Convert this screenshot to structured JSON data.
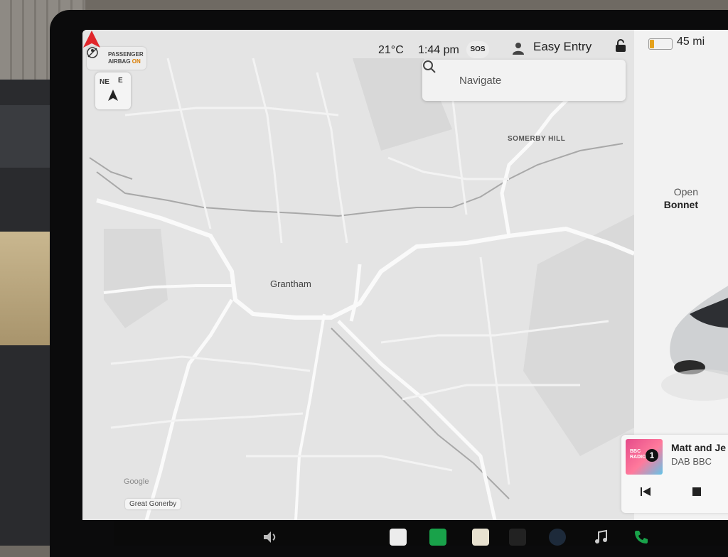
{
  "status": {
    "passenger_airbag_line1": "PASSENGER",
    "passenger_airbag_line2": "AIRBAG",
    "passenger_airbag_state": "ON",
    "temperature": "21°C",
    "time": "1:44 pm",
    "sos_label": "SOS",
    "profile_name": "Easy Entry",
    "range": "45 mi",
    "battery_level_pct": 20
  },
  "compass": {
    "label_ne": "NE",
    "label_e": "E"
  },
  "search": {
    "placeholder": "Navigate"
  },
  "map": {
    "labels": {
      "somerby_hill": "SOMERBY HILL",
      "grantham": "Grantham",
      "great_gonerby": "Great Gonerby",
      "google": "Google"
    }
  },
  "car_panel": {
    "open_label": "Open",
    "bonnet_label": "Bonnet"
  },
  "media": {
    "station_line1": "BBC",
    "station_line2": "RADIO",
    "station_number": "1",
    "title": "Matt and Je",
    "source": "DAB BBC"
  },
  "colors": {
    "accent_marker": "#e0262b",
    "airbag_on": "#d97c00",
    "battery": "#e5a21d",
    "dock_green": "#19a24a"
  },
  "icons": [
    "airbag-off-icon",
    "compass-arrow-icon",
    "search-icon",
    "profile-icon",
    "lock-icon",
    "battery-icon",
    "nav-arrow-icon",
    "prev-track-icon",
    "stop-icon",
    "volume-icon",
    "phone-icon"
  ]
}
